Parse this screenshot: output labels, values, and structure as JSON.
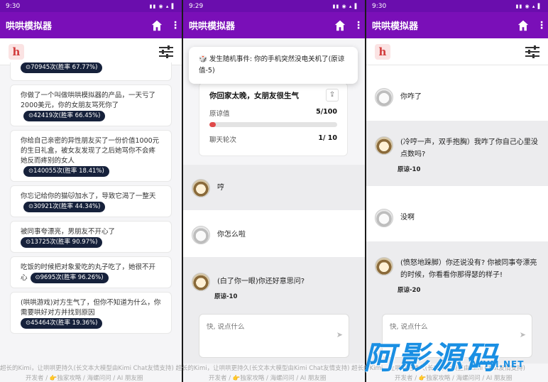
{
  "app": {
    "title": "哄哄模拟器"
  },
  "panels": [
    {
      "time": "9:30"
    },
    {
      "time": "9:29"
    },
    {
      "time": "9:30"
    }
  ],
  "scenarios": [
    {
      "text": "你回家太晚，女朋友很生气",
      "badge": "⊙70945次(胜率 67.77%)"
    },
    {
      "text": "你做了一个叫做哄哄模拟器的产品，一天亏了2000美元，你的女朋友骂死你了",
      "badge": "⊙42419次(胜率 66.45%)"
    },
    {
      "text": "你给自己亲密的异性朋友买了一份价值1000元的生日礼盒，被女友发现了之后她骂你不会疼她反而疼别的女人",
      "badge": "⊙140055次(胜率 18.41%)"
    },
    {
      "text": "你忘记给你的猫🐱加水了，导致它渴了一整天",
      "badge": "⊙30921次(胜率 44.34%)"
    },
    {
      "text": "被同事夸漂亮，男朋友不开心了",
      "badge": "⊙13725次(胜率 90.97%)"
    },
    {
      "text": "吃饭的时候把对象爱吃的丸子吃了，她很不开心",
      "badge": "⊙9695次(胜率 96.26%)"
    },
    {
      "text": "(哄哄游戏)对方生气了，但你不知道为什么，你需要哄好对方并找到原因",
      "badge": "⊙45464次(胜率 19.36%)"
    }
  ],
  "toast": {
    "text": "🎲 发生随机事件: 你的手机突然没电关机了(原谅值-5)"
  },
  "scene": {
    "title": "你回家太晚，女朋友很生气",
    "forgive_label": "原谅值",
    "forgive_value": "5/100",
    "forgive_fraction": 0.05,
    "rounds_label": "聊天轮次",
    "rounds_value": "1/ 10"
  },
  "chat2": [
    {
      "text": "哼"
    },
    {
      "text": "你怎么啦"
    },
    {
      "text": "(白了你一眼)你还好意思问?",
      "delta": "原谅-10"
    }
  ],
  "chat3": [
    {
      "text": "你咋了"
    },
    {
      "text": "(冷哼一声，双手抱胸）我咋了你自己心里没点数吗?",
      "delta": "原谅-10"
    },
    {
      "text": "没啊"
    },
    {
      "text": "(愤怒地跺脚）你还说没有? 你被同事夸漂亮的时候，你看看你那得瑟的样子!",
      "delta": "原谅-20"
    }
  ],
  "input": {
    "placeholder": "快, 说点什么"
  },
  "footer": {
    "line1": "超长的Kimi，让哄哄更持久(长文本大模型由Kimi Chat友情支持) 超长的Kimi，让哄哄更持久(长文本大模型由Kimi Chat友情支持) 超长的Kimi，让哄哄更持久(长文本大模型由Kimi Chat友情支持)",
    "line2a": "开发者 / 👉独家攻略 / 海螺问问 / AI 朋友圈",
    "line2b": "开发者 / 👉独家攻略 / 海螺问问 / AI 朋友圈",
    "line2c": "开发者 / 👉独家攻略 / 海螺问问 / AI 朋友圈"
  },
  "watermark": {
    "big": "阿影源码",
    "small": "AYYM.NET"
  }
}
